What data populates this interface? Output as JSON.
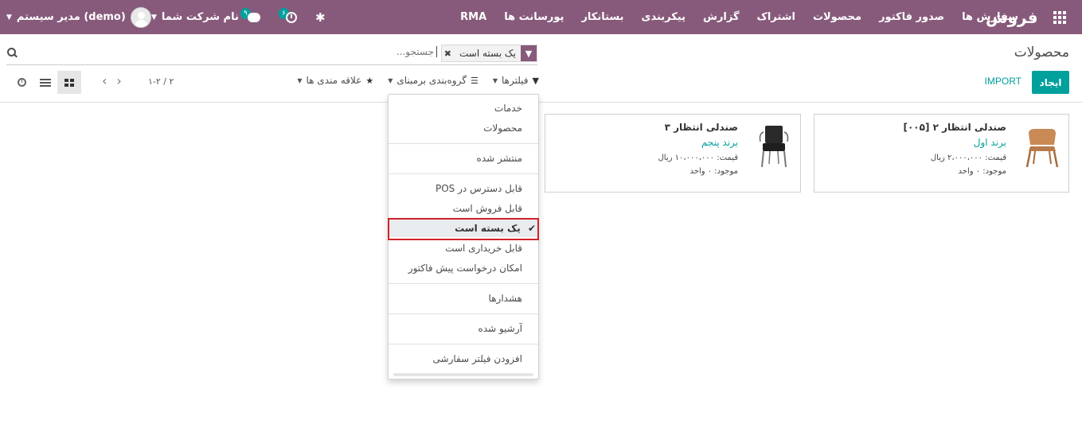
{
  "navbar": {
    "app_name": "فروش",
    "menu": [
      "سفارش ها",
      "صدور فاکتور",
      "محصولات",
      "اشتراک",
      "گزارش",
      "پیکربندی",
      "بستانکار",
      "پورسانت ها",
      "RMA"
    ],
    "user": "مدیر سیستم (demo)",
    "company": "نام شرکت شما",
    "chat_count": "۹",
    "activity_count": "۶"
  },
  "control_panel": {
    "title": "محصولات",
    "search_placeholder": "جستجو...",
    "facet_value": "یک بسته است",
    "create_label": "ایجاد",
    "import_label": "IMPORT",
    "filters_label": "فیلترها",
    "groupby_label": "گروه‌بندی برمبنای",
    "favorites_label": "علاقه مندی ها",
    "pager": "۱-۲ / ۲"
  },
  "filter_menu": {
    "items": [
      "خدمات",
      "محصولات",
      "منتشر شده",
      "قابل دسترس در POS",
      "قابل فروش است",
      "یک بسته است",
      "قابل خریداری است",
      "امکان درخواست پیش فاکتور",
      "هشدارها",
      "آرشیو شده",
      "افزودن فیلتر سفارشی"
    ],
    "selected": "یک بسته است"
  },
  "products": [
    {
      "name": "صندلی انتظار ۲",
      "ref": "[۰۰۵]",
      "brand": "برند اول",
      "price": "قیمت: ۲،۰۰۰،۰۰۰ ریال",
      "stock": "موجود: ۰ واحد"
    },
    {
      "name": "صندلی انتظار ۳",
      "ref": "",
      "brand": "برند پنجم",
      "price": "قیمت: ۱۰،۰۰۰،۰۰۰ ریال",
      "stock": "موجود: ۰ واحد"
    }
  ]
}
